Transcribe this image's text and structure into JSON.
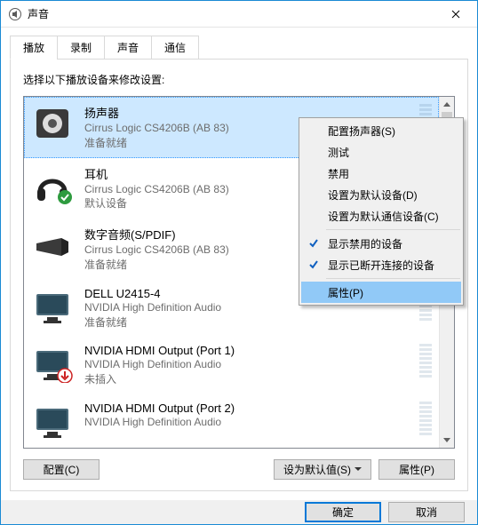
{
  "window": {
    "title": "声音"
  },
  "tabs": [
    {
      "label": "播放",
      "active": true
    },
    {
      "label": "录制",
      "active": false
    },
    {
      "label": "声音",
      "active": false
    },
    {
      "label": "通信",
      "active": false
    }
  ],
  "prompt": "选择以下播放设备来修改设置:",
  "devices": [
    {
      "name": "扬声器",
      "sub1": "Cirrus Logic CS4206B (AB 83)",
      "sub2": "准备就绪",
      "icon": "speaker",
      "selected": true,
      "badge": null
    },
    {
      "name": "耳机",
      "sub1": "Cirrus Logic CS4206B (AB 83)",
      "sub2": "默认设备",
      "icon": "headphones",
      "selected": false,
      "badge": "check"
    },
    {
      "name": "数字音频(S/PDIF)",
      "sub1": "Cirrus Logic CS4206B (AB 83)",
      "sub2": "准备就绪",
      "icon": "spdif",
      "selected": false,
      "badge": null
    },
    {
      "name": "DELL U2415-4",
      "sub1": "NVIDIA High Definition Audio",
      "sub2": "准备就绪",
      "icon": "monitor",
      "selected": false,
      "badge": null
    },
    {
      "name": "NVIDIA HDMI Output (Port 1)",
      "sub1": "NVIDIA High Definition Audio",
      "sub2": "未插入",
      "icon": "monitor",
      "selected": false,
      "badge": "down"
    },
    {
      "name": "NVIDIA HDMI Output (Port 2)",
      "sub1": "NVIDIA High Definition Audio",
      "sub2": "",
      "icon": "monitor",
      "selected": false,
      "badge": null
    }
  ],
  "context_menu": {
    "items": [
      {
        "label": "配置扬声器(S)",
        "checked": false
      },
      {
        "label": "测试",
        "checked": false
      },
      {
        "label": "禁用",
        "checked": false
      },
      {
        "label": "设置为默认设备(D)",
        "checked": false
      },
      {
        "label": "设置为默认通信设备(C)",
        "checked": false
      },
      {
        "sep": true
      },
      {
        "label": "显示禁用的设备",
        "checked": true
      },
      {
        "label": "显示已断开连接的设备",
        "checked": true
      },
      {
        "sep": true
      },
      {
        "label": "属性(P)",
        "checked": false,
        "hover": true
      }
    ]
  },
  "buttons": {
    "configure": "配置(C)",
    "set_default": "设为默认值(S)",
    "properties": "属性(P)",
    "ok": "确定",
    "cancel": "取消"
  }
}
